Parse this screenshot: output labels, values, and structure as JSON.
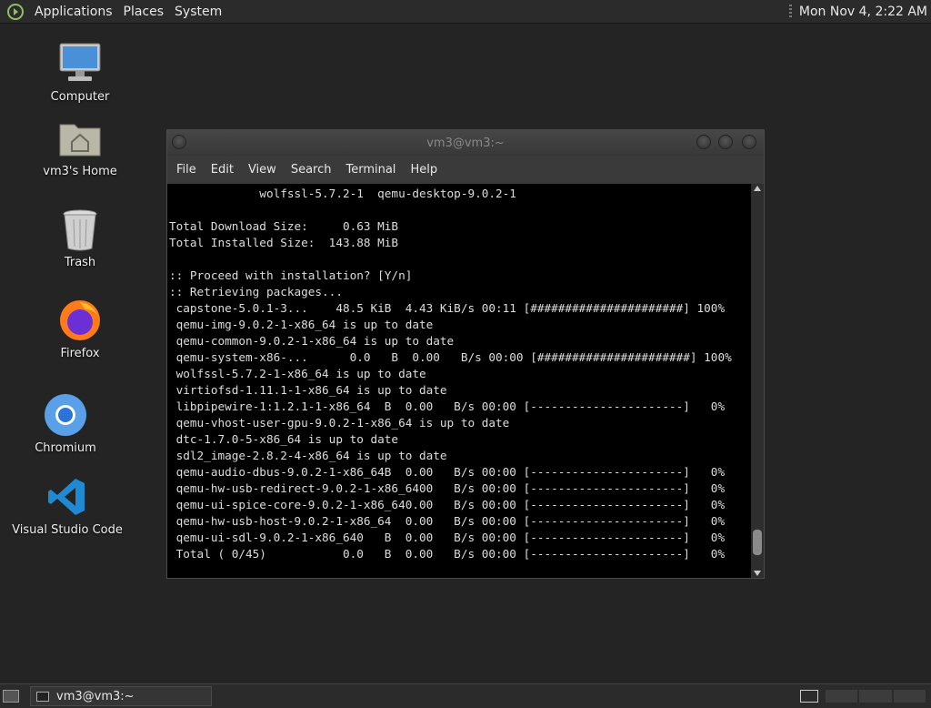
{
  "top_panel": {
    "menus": [
      "Applications",
      "Places",
      "System"
    ],
    "clock": "Mon Nov  4,  2:22 AM"
  },
  "desktop_icons": [
    {
      "label": "Computer",
      "icon": "computer-icon"
    },
    {
      "label": "vm3's Home",
      "icon": "home-folder-icon"
    },
    {
      "label": "Trash",
      "icon": "trash-icon"
    },
    {
      "label": "Firefox",
      "icon": "firefox-icon"
    },
    {
      "label": "Chromium",
      "icon": "chromium-icon"
    },
    {
      "label": "Visual Studio Code",
      "icon": "vscode-icon"
    }
  ],
  "terminal": {
    "title": "vm3@vm3:~",
    "menu": [
      "File",
      "Edit",
      "View",
      "Search",
      "Terminal",
      "Help"
    ],
    "lines": [
      "             wolfssl-5.7.2-1  qemu-desktop-9.0.2-1",
      "",
      "Total Download Size:     0.63 MiB",
      "Total Installed Size:  143.88 MiB",
      "",
      ":: Proceed with installation? [Y/n]",
      ":: Retrieving packages...",
      " capstone-5.0.1-3...    48.5 KiB  4.43 KiB/s 00:11 [######################] 100%",
      " qemu-img-9.0.2-1-x86_64 is up to date",
      " qemu-common-9.0.2-1-x86_64 is up to date",
      " qemu-system-x86-...      0.0   B  0.00   B/s 00:00 [######################] 100%",
      " wolfssl-5.7.2-1-x86_64 is up to date",
      " virtiofsd-1.11.1-1-x86_64 is up to date",
      " libpipewire-1:1.2.1-1-x86_64  B  0.00   B/s 00:00 [----------------------]   0%",
      " qemu-vhost-user-gpu-9.0.2-1-x86_64 is up to date",
      " dtc-1.7.0-5-x86_64 is up to date",
      " sdl2_image-2.8.2-4-x86_64 is up to date",
      " qemu-audio-dbus-9.0.2-1-x86_64B  0.00   B/s 00:00 [----------------------]   0%",
      " qemu-hw-usb-redirect-9.0.2-1-x86_6400   B/s 00:00 [----------------------]   0%",
      " qemu-ui-spice-core-9.0.2-1-x86_640.00   B/s 00:00 [----------------------]   0%",
      " qemu-hw-usb-host-9.0.2-1-x86_64  0.00   B/s 00:00 [----------------------]   0%",
      " qemu-ui-sdl-9.0.2-1-x86_640   B  0.00   B/s 00:00 [----------------------]   0%",
      " Total ( 0/45)           0.0   B  0.00   B/s 00:00 [----------------------]   0%"
    ]
  },
  "taskbar": {
    "task_label": "vm3@vm3:~"
  },
  "colors": {
    "desktop_bg": "#242424",
    "panel_bg": "#2b2b2b",
    "terminal_bg": "#000000",
    "terminal_fg": "#dddddd"
  }
}
